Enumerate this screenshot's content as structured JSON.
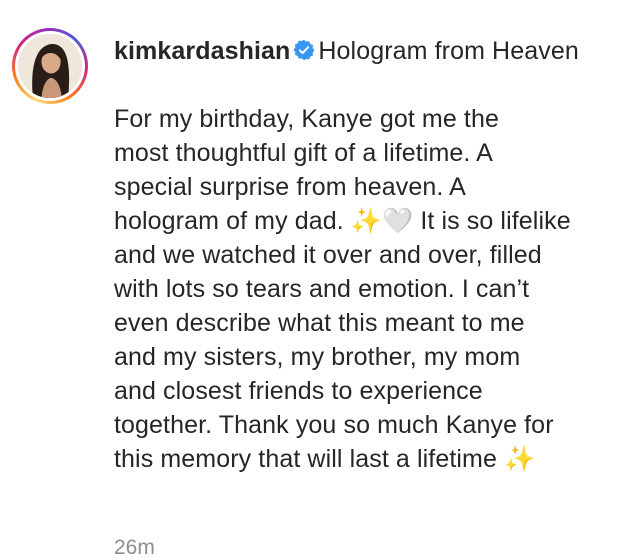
{
  "post": {
    "username": "kimkardashian",
    "verified": true,
    "title": "Hologram from Heaven",
    "body_lines": [
      "For my birthday, Kanye got me the",
      "most thoughtful gift of a lifetime. A",
      "special surprise from heaven. A",
      "hologram of my dad. ✨🤍 It is so lifelike",
      "and we watched it over and over, filled",
      "with lots so tears and emotion. I can’t",
      "even describe what this meant to me",
      "and my sisters, my brother, my mom",
      "and closest friends to experience",
      "together. Thank you so much Kanye for",
      "this memory that will last a lifetime ✨"
    ],
    "timestamp": "26m"
  },
  "colors": {
    "text": "#262626",
    "verified_badge": "#3897f0",
    "muted": "#8e8e8e"
  },
  "icons": {
    "verified": "verified-badge-icon",
    "avatar": "profile-avatar"
  }
}
